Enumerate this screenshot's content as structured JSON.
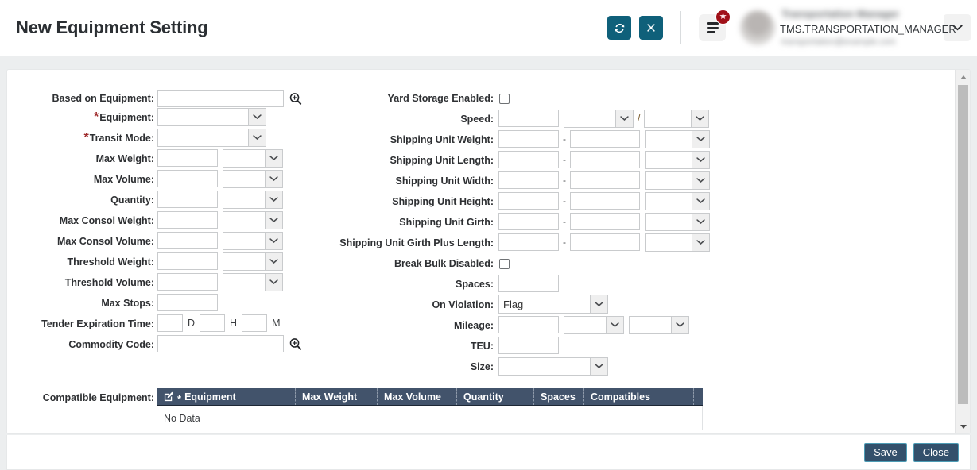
{
  "header": {
    "title": "New Equipment Setting",
    "refresh_icon": "refresh-icon",
    "close_icon": "close-x-icon",
    "menu_icon": "hamburger-menu-icon",
    "badge_icon": "star-badge-icon",
    "badge_glyph": "★",
    "avatar_icon": "user-avatar",
    "user_name_blurred": "Transportation Manager",
    "user_login": "TMS.TRANSPORTATION_MANAGER",
    "user_sub_blurred": "transportation@example.com",
    "caret_icon": "chevron-down-icon",
    "accent_teal": "#0f607a",
    "badge_red": "#a01018"
  },
  "form": {
    "left": {
      "based_on_equipment": {
        "label": "Based on Equipment:",
        "value": "",
        "lookup_icon": "magnifier-plus-icon"
      },
      "equipment": {
        "label": "Equipment:",
        "required": "*",
        "value": ""
      },
      "transit_mode": {
        "label": "Transit Mode:",
        "required": "*",
        "value": ""
      },
      "max_weight": {
        "label": "Max Weight:",
        "value": "",
        "uom": ""
      },
      "max_volume": {
        "label": "Max Volume:",
        "value": "",
        "uom": ""
      },
      "quantity": {
        "label": "Quantity:",
        "value": "",
        "uom": ""
      },
      "max_consol_weight": {
        "label": "Max Consol Weight:",
        "value": "",
        "uom": ""
      },
      "max_consol_volume": {
        "label": "Max Consol Volume:",
        "value": "",
        "uom": ""
      },
      "threshold_weight": {
        "label": "Threshold Weight:",
        "value": "",
        "uom": ""
      },
      "threshold_volume": {
        "label": "Threshold Volume:",
        "value": "",
        "uom": ""
      },
      "max_stops": {
        "label": "Max Stops:",
        "value": ""
      },
      "tender_expiration_time": {
        "label": "Tender Expiration Time:",
        "days": "",
        "days_unit": "D",
        "hours": "",
        "hours_unit": "H",
        "minutes": "",
        "minutes_unit": "M"
      },
      "commodity_code": {
        "label": "Commodity Code:",
        "value": "",
        "lookup_icon": "magnifier-plus-icon"
      }
    },
    "right": {
      "yard_storage_enabled": {
        "label": "Yard Storage Enabled:",
        "checked": false
      },
      "speed": {
        "label": "Speed:",
        "value": "",
        "uom1": "",
        "separator": "/",
        "uom2": ""
      },
      "shipping_unit_weight": {
        "label": "Shipping Unit Weight:",
        "from": "",
        "sep": "-",
        "to": "",
        "uom": ""
      },
      "shipping_unit_length": {
        "label": "Shipping Unit Length:",
        "from": "",
        "sep": "-",
        "to": "",
        "uom": ""
      },
      "shipping_unit_width": {
        "label": "Shipping Unit Width:",
        "from": "",
        "sep": "-",
        "to": "",
        "uom": ""
      },
      "shipping_unit_height": {
        "label": "Shipping Unit Height:",
        "from": "",
        "sep": "-",
        "to": "",
        "uom": ""
      },
      "shipping_unit_girth": {
        "label": "Shipping Unit Girth:",
        "from": "",
        "sep": "-",
        "to": "",
        "uom": ""
      },
      "shipping_unit_girth_plus_length": {
        "label": "Shipping Unit Girth Plus Length:",
        "from": "",
        "sep": "-",
        "to": "",
        "uom": ""
      },
      "break_bulk_disabled": {
        "label": "Break Bulk Disabled:",
        "checked": false
      },
      "spaces": {
        "label": "Spaces:",
        "value": ""
      },
      "on_violation": {
        "label": "On Violation:",
        "value": "Flag"
      },
      "mileage": {
        "label": "Mileage:",
        "value": "",
        "uom1": "",
        "uom2": ""
      },
      "teu": {
        "label": "TEU:",
        "value": ""
      },
      "size": {
        "label": "Size:",
        "value": ""
      }
    }
  },
  "table": {
    "label": "Compatible Equipment:",
    "edit_icon": "edit-pencil-icon",
    "required_marker": "*",
    "columns": [
      "Equipment",
      "Max Weight",
      "Max Volume",
      "Quantity",
      "Spaces",
      "Compatibles"
    ],
    "empty_message": "No Data",
    "header_bg": "#42536b"
  },
  "scrollbar": {
    "up_icon": "scroll-up-arrow",
    "down_icon": "scroll-down-arrow"
  },
  "footer": {
    "save_label": "Save",
    "close_label": "Close",
    "button_bg": "#33506b",
    "button_border": "#4d9cb5"
  }
}
